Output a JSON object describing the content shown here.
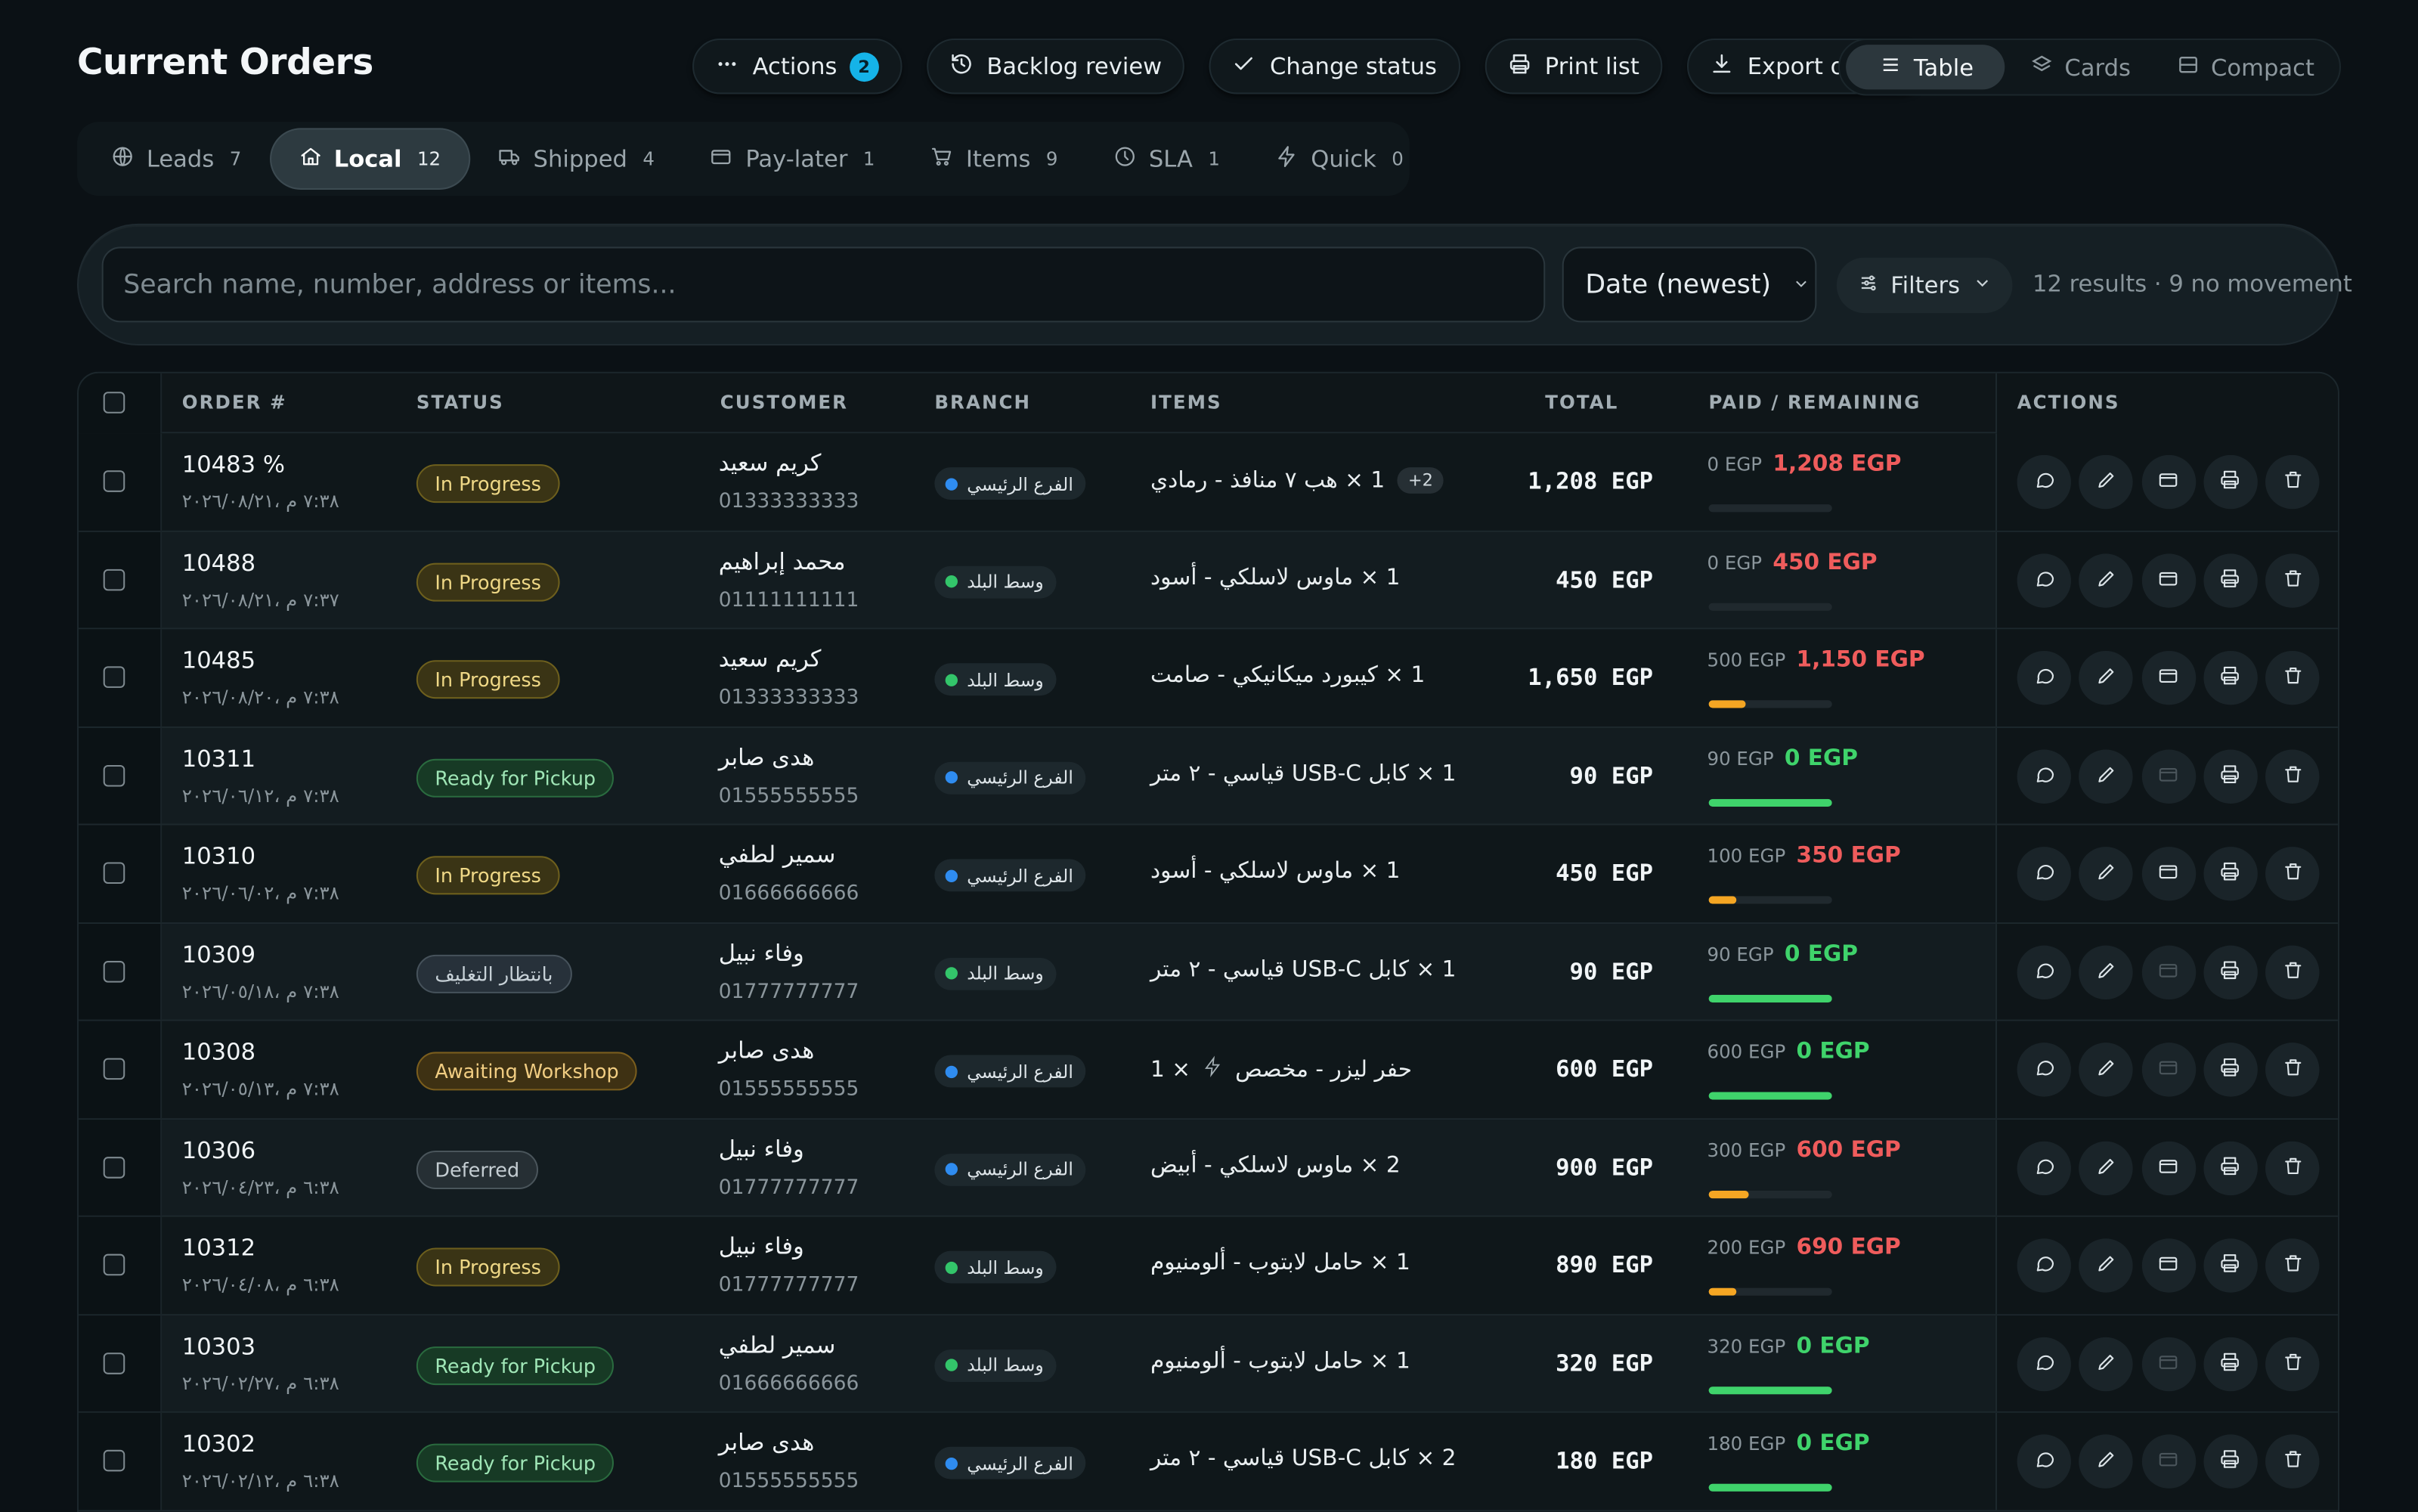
{
  "page": {
    "title": "Current Orders"
  },
  "toolbar": {
    "actions_label": "Actions",
    "actions_badge": "2",
    "backlog_label": "Backlog review",
    "status_label": "Change status",
    "print_label": "Print list",
    "export_label": "Export orders"
  },
  "views": [
    {
      "label": "Table",
      "active": true
    },
    {
      "label": "Cards",
      "active": false
    },
    {
      "label": "Compact",
      "active": false
    }
  ],
  "tabs": [
    {
      "label": "Leads",
      "count": "7",
      "icon": "globe-icon",
      "active": false
    },
    {
      "label": "Local",
      "count": "12",
      "icon": "home-icon",
      "active": true
    },
    {
      "label": "Shipped",
      "count": "4",
      "icon": "truck-icon",
      "active": false
    },
    {
      "label": "Pay-later",
      "count": "1",
      "icon": "wallet-icon",
      "active": false
    },
    {
      "label": "Items",
      "count": "9",
      "icon": "cart-icon",
      "active": false
    },
    {
      "label": "SLA",
      "count": "1",
      "icon": "clock-icon",
      "active": false
    },
    {
      "label": "Quick",
      "count": "0",
      "icon": "bolt-icon",
      "active": false
    }
  ],
  "search": {
    "placeholder": "Search name, number, address or items...",
    "sort_value": "Date (newest)",
    "filters_label": "Filters",
    "result_summary": "12 results · 9 no movement"
  },
  "table": {
    "headers": [
      "ORDER #",
      "STATUS",
      "CUSTOMER",
      "BRANCH",
      "ITEMS",
      "TOTAL",
      "PAID / REMAINING",
      "ACTIONS"
    ],
    "rows": [
      {
        "order": "10483 %",
        "date": "٧:٣٨ م ،٢٠٢٦/٠٨/٢١",
        "status": "In Progress",
        "status_kind": "progress",
        "customer": "كريم سعيد",
        "phone": "01333333333",
        "branch": "الفرع الرئيسي",
        "branch_color": "#2f8cf0",
        "items": "1 × هب ٧ منافذ - رمادي",
        "extra": "+2",
        "bolt": false,
        "total": "1,208 EGP",
        "paid": "0 EGP",
        "remaining": "1,208 EGP",
        "remaining_kind": "red",
        "paid_fraction": 0,
        "wallet_enabled": true
      },
      {
        "order": "10488",
        "date": "٧:٣٧ م ،٢٠٢٦/٠٨/٢١",
        "status": "In Progress",
        "status_kind": "progress",
        "customer": "محمد إبراهيم",
        "phone": "01111111111",
        "branch": "وسط البلد",
        "branch_color": "#33c56a",
        "items": "1 × ماوس لاسلكي - أسود",
        "extra": "",
        "bolt": false,
        "total": "450 EGP",
        "paid": "0 EGP",
        "remaining": "450 EGP",
        "remaining_kind": "red",
        "paid_fraction": 0,
        "wallet_enabled": true
      },
      {
        "order": "10485",
        "date": "٧:٣٨ م ،٢٠٢٦/٠٨/٢٠",
        "status": "In Progress",
        "status_kind": "progress",
        "customer": "كريم سعيد",
        "phone": "01333333333",
        "branch": "وسط البلد",
        "branch_color": "#33c56a",
        "items": "1 × كيبورد ميكانيكي - صامت",
        "extra": "",
        "bolt": false,
        "total": "1,650 EGP",
        "paid": "500 EGP",
        "remaining": "1,150 EGP",
        "remaining_kind": "red",
        "paid_fraction": 0.3,
        "wallet_enabled": true
      },
      {
        "order": "10311",
        "date": "٧:٣٨ م ،٢٠٢٦/٠٦/١٢",
        "status": "Ready for Pickup",
        "status_kind": "ready",
        "customer": "هدى صابر",
        "phone": "01555555555",
        "branch": "الفرع الرئيسي",
        "branch_color": "#2f8cf0",
        "items": "1 × كابل USB-C قياسي - ٢ متر",
        "extra": "",
        "bolt": false,
        "total": "90 EGP",
        "paid": "90 EGP",
        "remaining": "0 EGP",
        "remaining_kind": "green",
        "paid_fraction": 1,
        "wallet_enabled": false
      },
      {
        "order": "10310",
        "date": "٧:٣٨ م ،٢٠٢٦/٠٦/٠٢",
        "status": "In Progress",
        "status_kind": "progress",
        "customer": "سمير لطفي",
        "phone": "01666666666",
        "branch": "الفرع الرئيسي",
        "branch_color": "#2f8cf0",
        "items": "1 × ماوس لاسلكي - أسود",
        "extra": "",
        "bolt": false,
        "total": "450 EGP",
        "paid": "100 EGP",
        "remaining": "350 EGP",
        "remaining_kind": "red",
        "paid_fraction": 0.22,
        "wallet_enabled": true
      },
      {
        "order": "10309",
        "date": "٧:٣٨ م ،٢٠٢٦/٠٥/١٨",
        "status": "بانتظار التغليف",
        "status_kind": "wait",
        "customer": "وفاء نبيل",
        "phone": "01777777777",
        "branch": "وسط البلد",
        "branch_color": "#33c56a",
        "items": "1 × كابل USB-C قياسي - ٢ متر",
        "extra": "",
        "bolt": false,
        "total": "90 EGP",
        "paid": "90 EGP",
        "remaining": "0 EGP",
        "remaining_kind": "green",
        "paid_fraction": 1,
        "wallet_enabled": false
      },
      {
        "order": "10308",
        "date": "٧:٣٨ م ،٢٠٢٦/٠٥/١٣",
        "status": "Awaiting Workshop",
        "status_kind": "workshop",
        "customer": "هدى صابر",
        "phone": "01555555555",
        "branch": "الفرع الرئيسي",
        "branch_color": "#2f8cf0",
        "items": "حفر ليزر - مخصص",
        "extra": "",
        "bolt": true,
        "total": "600 EGP",
        "paid": "600 EGP",
        "remaining": "0 EGP",
        "remaining_kind": "green",
        "paid_fraction": 1,
        "wallet_enabled": false
      },
      {
        "order": "10306",
        "date": "٦:٣٨ م ،٢٠٢٦/٠٤/٢٣",
        "status": "Deferred",
        "status_kind": "deferred",
        "customer": "وفاء نبيل",
        "phone": "01777777777",
        "branch": "الفرع الرئيسي",
        "branch_color": "#2f8cf0",
        "items": "2 × ماوس لاسلكي - أبيض",
        "extra": "",
        "bolt": false,
        "total": "900 EGP",
        "paid": "300 EGP",
        "remaining": "600 EGP",
        "remaining_kind": "red",
        "paid_fraction": 0.33,
        "wallet_enabled": true
      },
      {
        "order": "10312",
        "date": "٦:٣٨ م ،٢٠٢٦/٠٤/٠٨",
        "status": "In Progress",
        "status_kind": "progress",
        "customer": "وفاء نبيل",
        "phone": "01777777777",
        "branch": "وسط البلد",
        "branch_color": "#33c56a",
        "items": "1 × حامل لابتوب - ألومنيوم",
        "extra": "",
        "bolt": false,
        "total": "890 EGP",
        "paid": "200 EGP",
        "remaining": "690 EGP",
        "remaining_kind": "red",
        "paid_fraction": 0.22,
        "wallet_enabled": true
      },
      {
        "order": "10303",
        "date": "٦:٣٨ م ،٢٠٢٦/٠٢/٢٧",
        "status": "Ready for Pickup",
        "status_kind": "ready",
        "customer": "سمير لطفي",
        "phone": "01666666666",
        "branch": "وسط البلد",
        "branch_color": "#33c56a",
        "items": "1 × حامل لابتوب - ألومنيوم",
        "extra": "",
        "bolt": false,
        "total": "320 EGP",
        "paid": "320 EGP",
        "remaining": "0 EGP",
        "remaining_kind": "green",
        "paid_fraction": 1,
        "wallet_enabled": false
      },
      {
        "order": "10302",
        "date": "٦:٣٨ م ،٢٠٢٦/٠٢/١٢",
        "status": "Ready for Pickup",
        "status_kind": "ready",
        "customer": "هدى صابر",
        "phone": "01555555555",
        "branch": "الفرع الرئيسي",
        "branch_color": "#2f8cf0",
        "items": "2 × كابل USB-C قياسي - ٢ متر",
        "extra": "",
        "bolt": false,
        "total": "180 EGP",
        "paid": "180 EGP",
        "remaining": "0 EGP",
        "remaining_kind": "green",
        "paid_fraction": 1,
        "wallet_enabled": false
      }
    ]
  },
  "colors": {
    "progress_orange": "#f5a623",
    "progress_green": "#3fd36b",
    "accent_cyan": "#15b3e8"
  }
}
